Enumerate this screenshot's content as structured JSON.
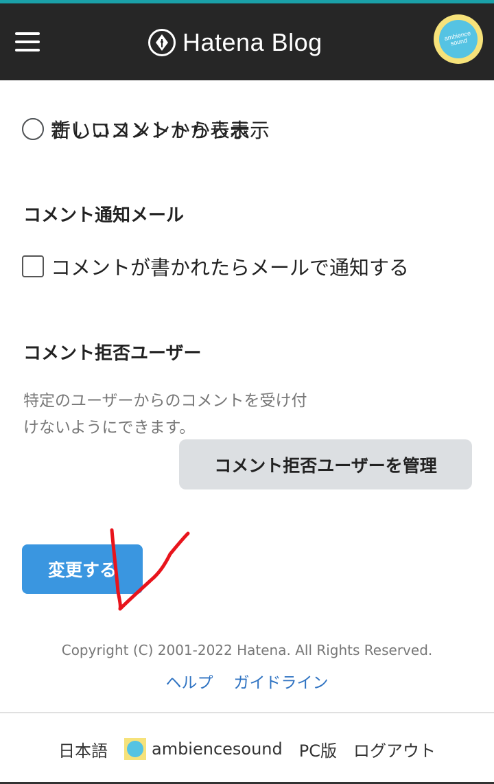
{
  "header": {
    "logo_text": "Hatena Blog",
    "avatar_text": "ambience sound"
  },
  "comment_order": {
    "partial_option": "古いコメントから表示",
    "newest_option": "新しいコメントから表示"
  },
  "notification": {
    "title": "コメント通知メール",
    "checkbox_label": "コメントが書かれたらメールで通知する"
  },
  "blocked_users": {
    "title": "コメント拒否ユーザー",
    "description_line1": "特定のユーザーからのコメントを受け付",
    "description_line2": "けないようにできます。",
    "manage_button": "コメント拒否ユーザーを管理"
  },
  "submit_button": "変更する",
  "footer": {
    "copyright": "Copyright (C) 2001-2022 Hatena. All Rights Reserved.",
    "help_link": "ヘルプ",
    "guideline_link": "ガイドライン"
  },
  "bottom_bar": {
    "language": "日本語",
    "username": "ambiencesound",
    "pc_version": "PC版",
    "logout": "ログアウト"
  },
  "colors": {
    "header_bg": "#262626",
    "accent_teal": "#1aa0a8",
    "submit_blue": "#3a96e0",
    "link_blue": "#2f73c2",
    "annotation_red": "#e8141c"
  }
}
